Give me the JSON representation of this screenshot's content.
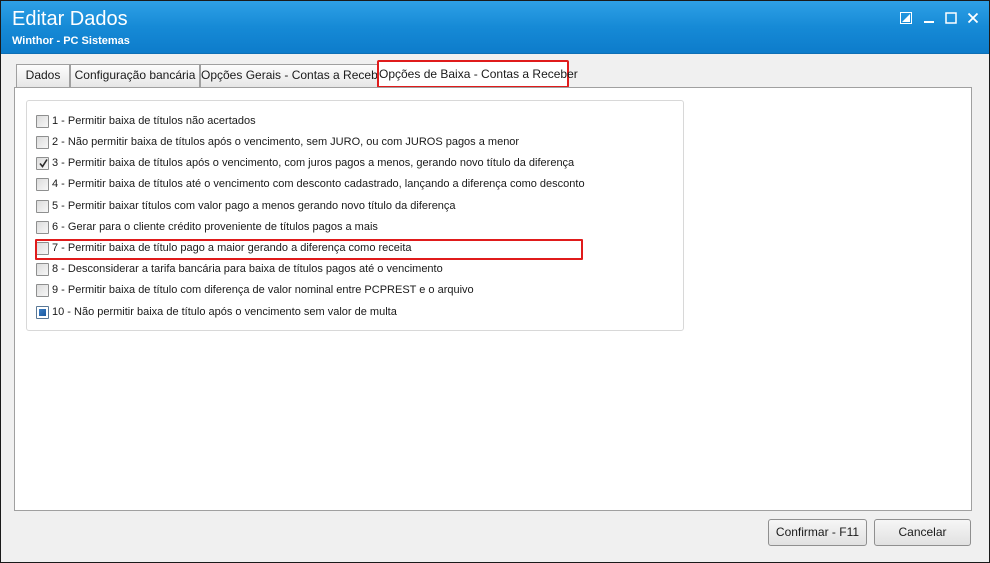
{
  "window": {
    "title": "Editar Dados",
    "subtitle": "Winthor - PC Sistemas",
    "controls": [
      "edit-icon",
      "minimize-icon",
      "maximize-icon",
      "close-icon"
    ]
  },
  "tabs": [
    {
      "label": "Dados",
      "active": false
    },
    {
      "label": "Configuração bancária",
      "active": false
    },
    {
      "label": "Opções Gerais - Contas a Receber",
      "active": false
    },
    {
      "label": "Opções de Baixa - Contas a Receber",
      "active": true
    }
  ],
  "options": [
    {
      "label": "1 - Permitir baixa de títulos não acertados",
      "checked": false
    },
    {
      "label": "2 - Não permitir baixa de títulos após o vencimento, sem JURO, ou com JUROS pagos a menor",
      "checked": false
    },
    {
      "label": "3 - Permitir baixa de títulos após o vencimento, com juros pagos a menos, gerando novo título da diferença",
      "checked": true
    },
    {
      "label": "4 - Permitir baixa de títulos até o vencimento com desconto cadastrado, lançando a diferença como desconto",
      "checked": false
    },
    {
      "label": "5 - Permitir baixar títulos com valor pago a menos gerando novo título da diferença",
      "checked": false
    },
    {
      "label": "6 - Gerar para o cliente crédito proveniente de títulos pagos a mais",
      "checked": false
    },
    {
      "label": "7 - Permitir baixa de título pago a maior gerando a diferença como receita",
      "checked": false
    },
    {
      "label": "8 - Desconsiderar a tarifa bancária para baixa de títulos pagos até o vencimento",
      "checked": false
    },
    {
      "label": "9 - Permitir baixa de título com diferença de valor nominal entre PCPREST e o arquivo",
      "checked": false
    },
    {
      "label": "10 - Não permitir baixa de título após o vencimento sem valor de multa",
      "checked": "indeterminate"
    }
  ],
  "buttons": {
    "confirm_label": "Confirmar - F11",
    "cancel_label": "Cancelar"
  },
  "colors": {
    "titlebar": "#168ad6",
    "highlight": "#e01b1b"
  }
}
